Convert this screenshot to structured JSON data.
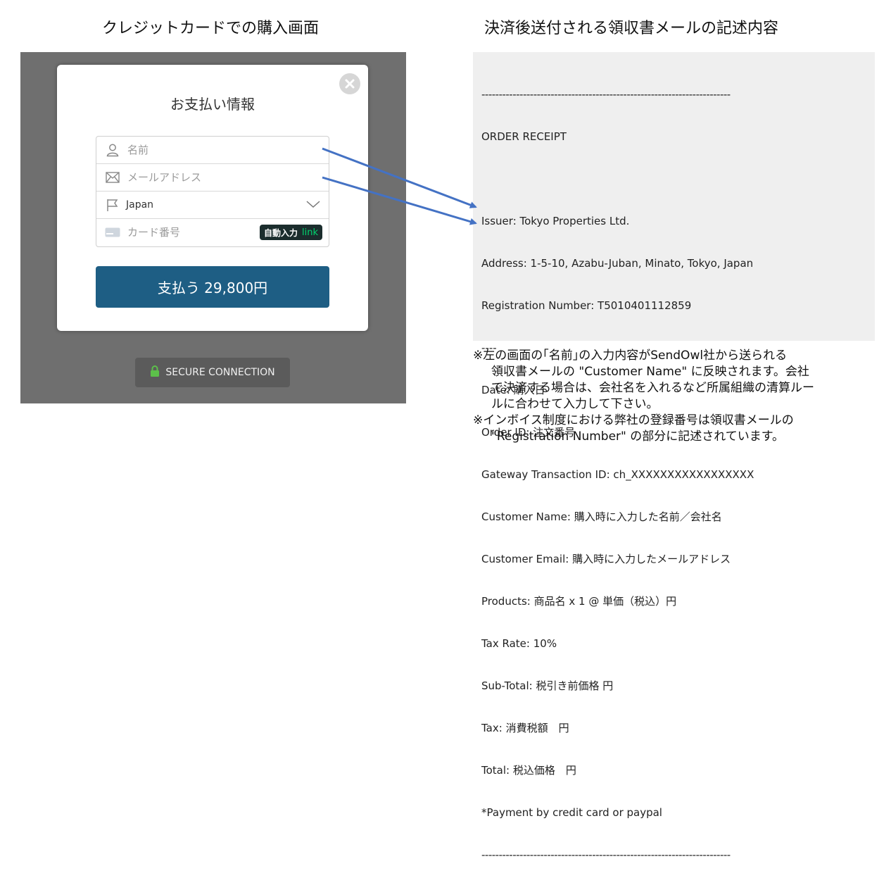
{
  "titles": {
    "left": "クレジットカードでの購入画面",
    "right": "決済後送付される領収書メールの記述内容"
  },
  "payment_modal": {
    "title": "お支払い情報",
    "name_placeholder": "名前",
    "email_placeholder": "メールアドレス",
    "country": "Japan",
    "card_placeholder": "カード番号",
    "autofill_badge": "自動入力",
    "autofill_brand": "link",
    "pay_button": "支払う 29,800円",
    "secure_label": "SECURE CONNECTION"
  },
  "receipt": {
    "lines": [
      "------------------------------------------------------------------------",
      "ORDER RECEIPT",
      "",
      "Issuer: Tokyo Properties Ltd.",
      "Address: 1-5-10, Azabu-Juban, Minato, Tokyo, Japan",
      "Registration Number: T5010401112859",
      "----",
      "Date: 購入日",
      "Order ID: 注文番号",
      "Gateway Transaction ID: ch_XXXXXXXXXXXXXXXXX",
      "Customer Name: 購入時に入力した名前／会社名",
      "Customer Email: 購入時に入力したメールアドレス",
      "Products: 商品名 x 1 @ 単価（税込）円",
      "Tax Rate: 10%",
      "Sub-Total: 税引き前価格 円",
      "Tax: 消費税額　円",
      "Total: 税込価格　円",
      "*Payment by credit card or paypal",
      "------------------------------------------------------------------------"
    ]
  },
  "notes": [
    "※左の画面の｢名前｣の入力内容がSendOwl社から送られる",
    "領収書メールの \"Customer Name\" に反映されます。会社",
    "で決済する場合は、会社名を入れるなど所属組織の清算ルー",
    "ルに合わせて入力して下さい。",
    "※インボイス制度における弊社の登録番号は領収書メールの",
    "\"Registration Number\" の部分に記述されています。"
  ],
  "colors": {
    "pay_button": "#1e5e84",
    "arrow": "#4472c4",
    "link_badge": "#1b2d2d",
    "link_brand": "#00d66f"
  }
}
